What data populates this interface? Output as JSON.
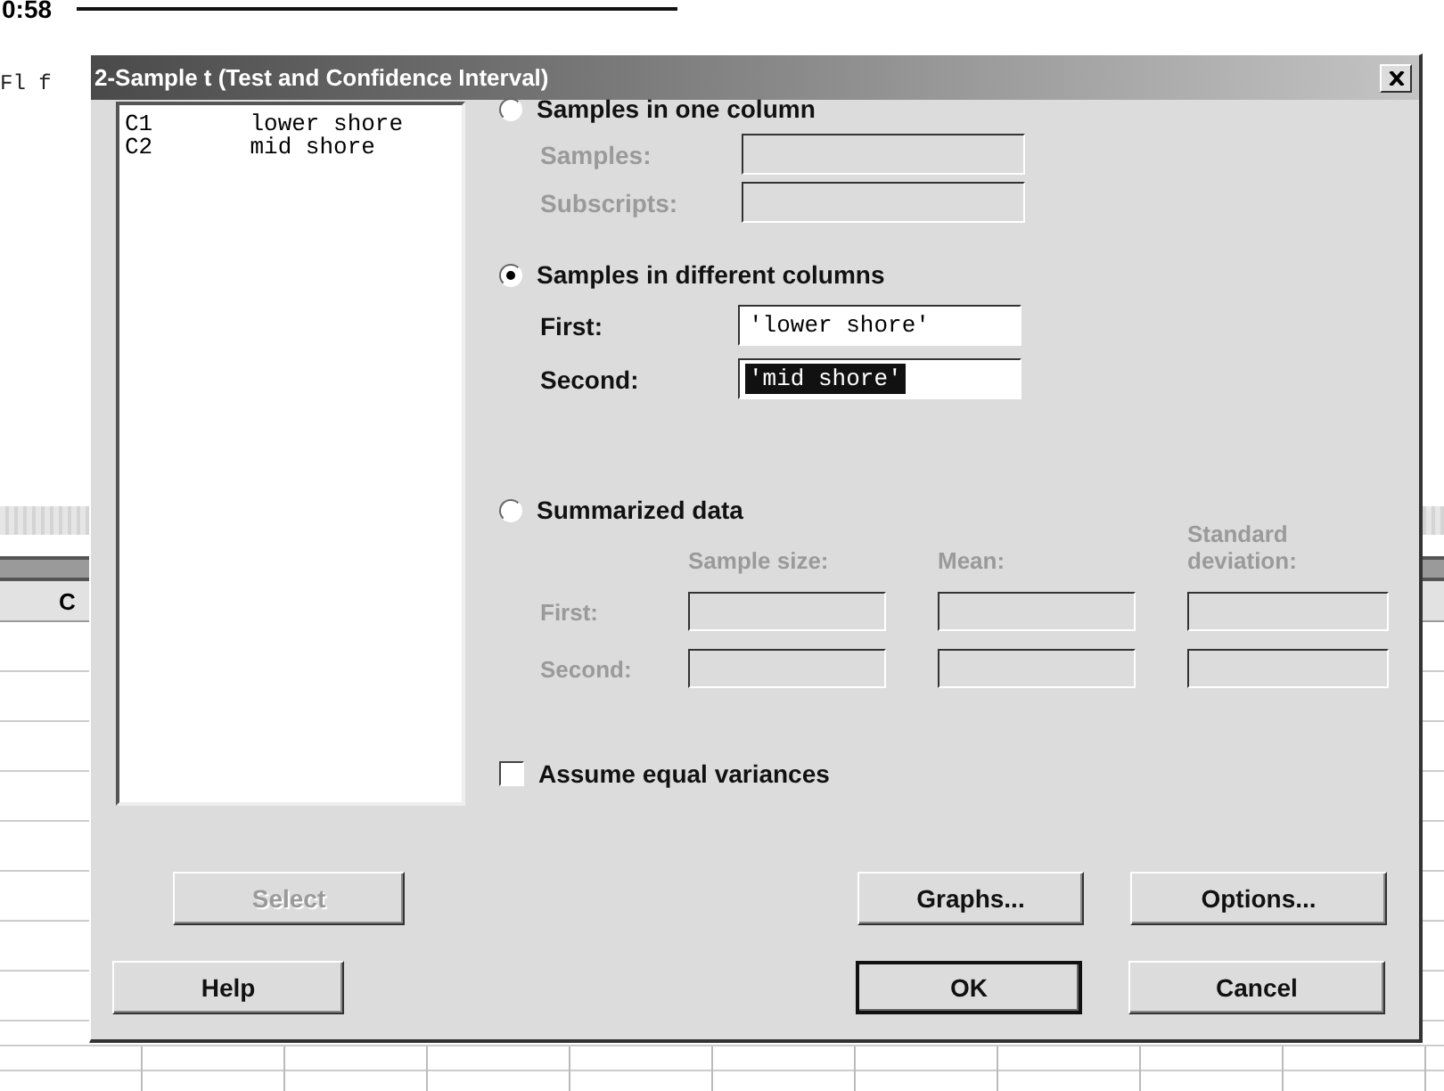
{
  "session": {
    "time": "0:58",
    "text": "Fl f"
  },
  "worksheet": {
    "column_header": "C"
  },
  "dialog": {
    "title": "2-Sample t (Test and Confidence Interval)",
    "variables": [
      {
        "column": "C1",
        "name": "lower shore"
      },
      {
        "column": "C2",
        "name": "mid shore"
      }
    ],
    "options": [
      {
        "kind": "single",
        "label": "Samples in one column",
        "selected": false,
        "fields": [
          {
            "label": "Samples:",
            "disabled": true
          },
          {
            "label": "Subscripts:",
            "disabled": true
          }
        ]
      },
      {
        "kind": "pair",
        "label": "Samples in different columns",
        "selected": true,
        "fields": [
          {
            "label": "First:",
            "value": "'lower shore'",
            "disabled": false,
            "highlighted": false
          },
          {
            "label": "Second:",
            "value": "'mid shore'",
            "disabled": false,
            "highlighted": true
          }
        ]
      },
      {
        "kind": "summary",
        "label": "Summarized data",
        "selected": false,
        "disabled": true,
        "columns": [
          "Sample size:",
          "Mean:",
          "Standard deviation:"
        ],
        "rows": [
          "First:",
          "Second:"
        ]
      }
    ],
    "equal_variances": {
      "label": "Assume equal variances",
      "checked": false
    },
    "button_rows": [
      [
        {
          "label": "Select",
          "disabled": true
        },
        {
          "label": "Graphs...",
          "disabled": false
        },
        {
          "label": "Options...",
          "disabled": false
        }
      ],
      [
        {
          "label": "Help",
          "disabled": false,
          "default": false
        },
        {
          "label": "OK",
          "disabled": false,
          "default": true
        },
        {
          "label": "Cancel",
          "disabled": false,
          "default": false
        }
      ]
    ]
  }
}
